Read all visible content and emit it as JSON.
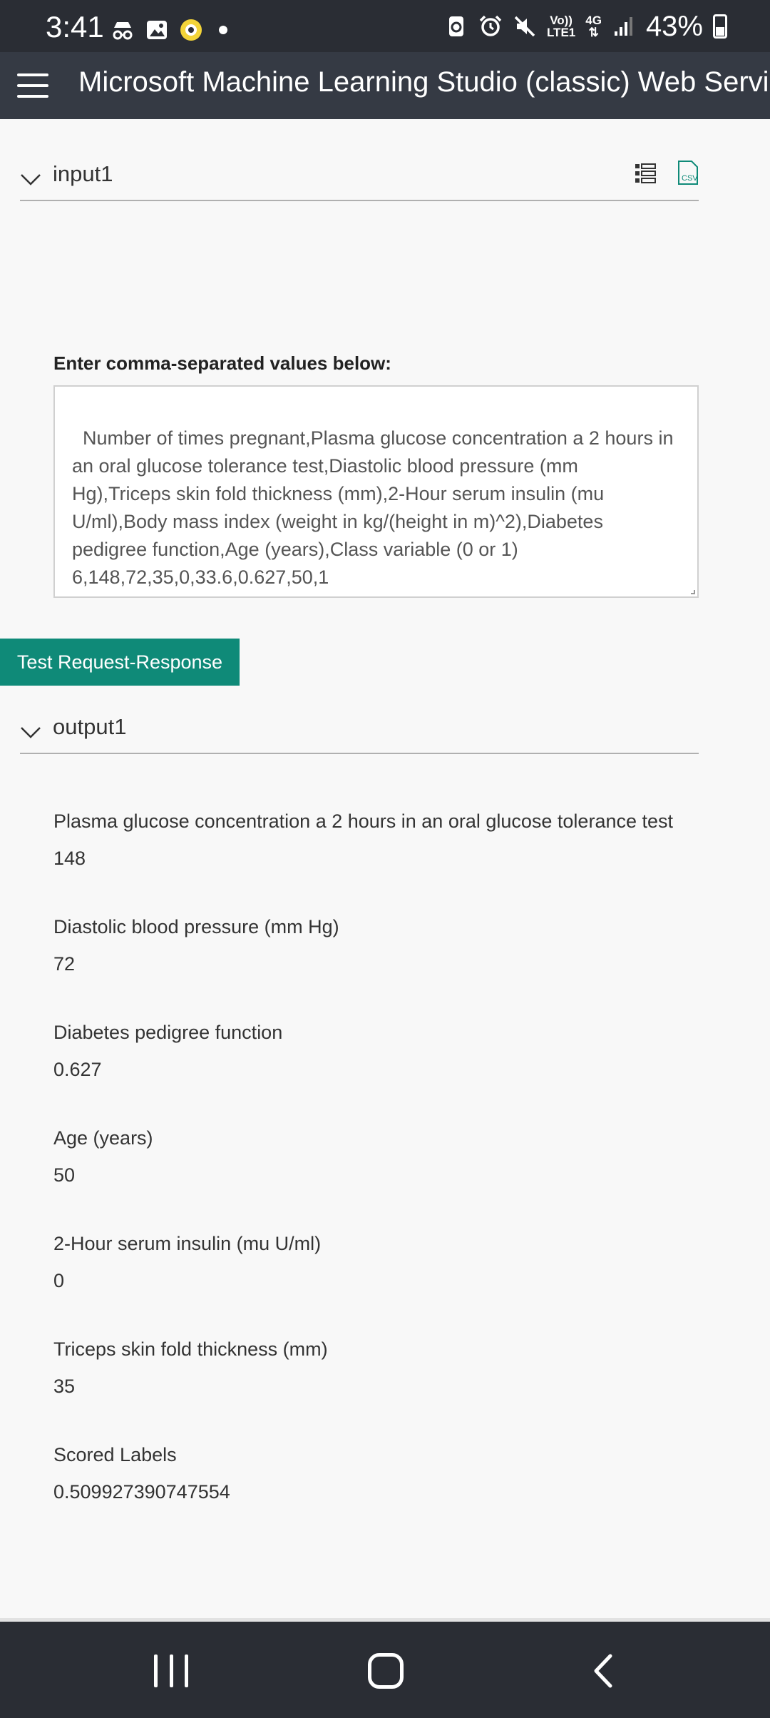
{
  "status_bar": {
    "time": "3:41",
    "network_top": "Vo))",
    "network_bottom": "LTE1",
    "gen": "4G",
    "battery": "43%"
  },
  "app": {
    "title": "Microsoft Machine Learning Studio (classic) Web Servic"
  },
  "input_section": {
    "title": "input1",
    "prompt": "Enter comma-separated values below:",
    "csv_value": "Number of times pregnant,Plasma glucose concentration a 2 hours in an oral glucose tolerance test,Diastolic blood pressure (mm Hg),Triceps skin fold thickness (mm),2-Hour serum insulin (mu U/ml),Body mass index (weight in kg/(height in m)^2),Diabetes pedigree function,Age (years),Class variable (0 or 1)\n6,148,72,35,0,33.6,0.627,50,1",
    "icons": [
      "grid-view-icon",
      "csv-icon"
    ]
  },
  "actions": {
    "test_button": "Test Request-Response"
  },
  "output_section": {
    "title": "output1",
    "items": [
      {
        "label": "Plasma glucose concentration a 2 hours in an oral glucose tolerance test",
        "value": "148"
      },
      {
        "label": "Diastolic blood pressure (mm Hg)",
        "value": "72"
      },
      {
        "label": "Diabetes pedigree function",
        "value": "0.627"
      },
      {
        "label": "Age (years)",
        "value": "50"
      },
      {
        "label": "2-Hour serum insulin (mu U/ml)",
        "value": "0"
      },
      {
        "label": "Triceps skin fold thickness (mm)",
        "value": "35"
      },
      {
        "label": "Scored Labels",
        "value": "0.509927390747554"
      }
    ]
  },
  "colors": {
    "accent": "#0f8a78",
    "header": "#353a44",
    "system_bars": "#2a2d34"
  }
}
